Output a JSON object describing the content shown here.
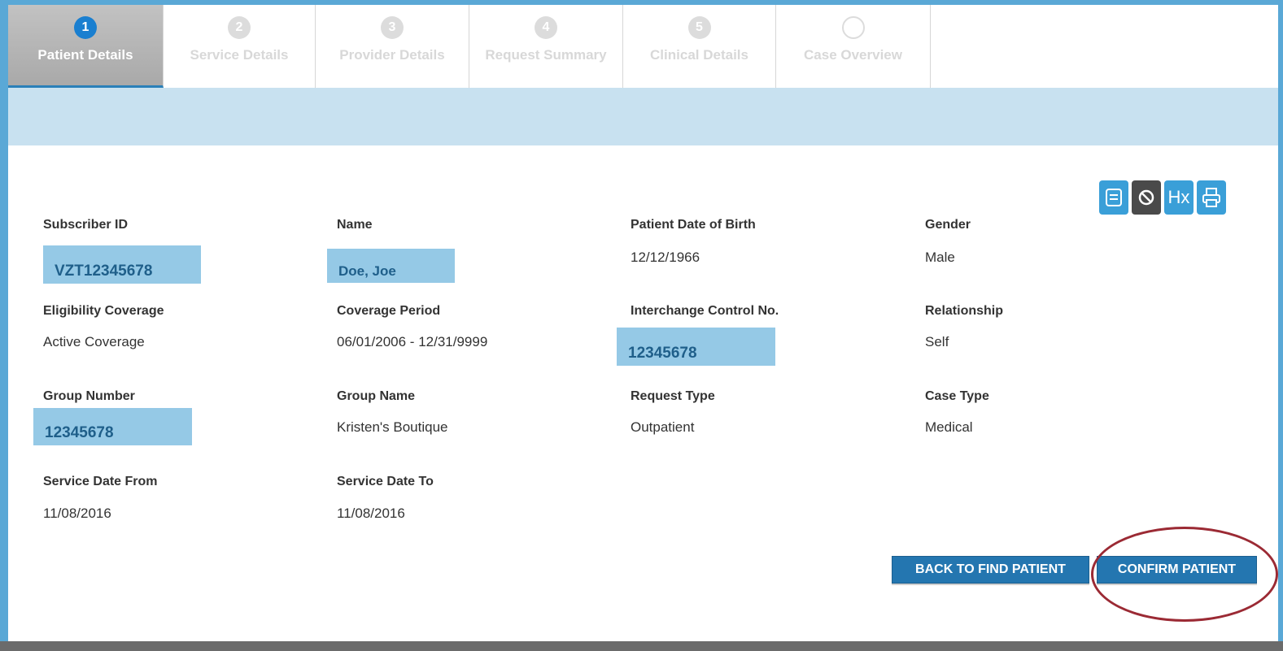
{
  "steps": [
    {
      "num": "1",
      "label": "Patient Details"
    },
    {
      "num": "2",
      "label": "Service Details"
    },
    {
      "num": "3",
      "label": "Provider Details"
    },
    {
      "num": "4",
      "label": "Request Summary"
    },
    {
      "num": "5",
      "label": "Clinical Details"
    },
    {
      "num": "",
      "label": "Case Overview"
    }
  ],
  "toolbar": {
    "icons": [
      "save-icon",
      "cancel-icon",
      "hx-icon",
      "print-icon"
    ],
    "hx_text": "Hx"
  },
  "fields": {
    "subscriber_id": {
      "label": "Subscriber ID",
      "value": "VZT12345678"
    },
    "name": {
      "label": "Name",
      "value": "Doe, Joe"
    },
    "dob": {
      "label": "Patient Date of Birth",
      "value": "12/12/1966"
    },
    "gender": {
      "label": "Gender",
      "value": "Male"
    },
    "eligibility": {
      "label": "Eligibility Coverage",
      "value": "Active Coverage"
    },
    "coverage_period": {
      "label": "Coverage Period",
      "value": "06/01/2006 - 12/31/9999"
    },
    "icn": {
      "label": "Interchange Control No.",
      "value": "12345678"
    },
    "relationship": {
      "label": "Relationship",
      "value": "Self"
    },
    "group_number": {
      "label": "Group Number",
      "value": "12345678"
    },
    "group_name": {
      "label": "Group Name",
      "value": "Kristen's Boutique"
    },
    "request_type": {
      "label": "Request Type",
      "value": "Outpatient"
    },
    "case_type": {
      "label": "Case Type",
      "value": "Medical"
    },
    "service_from": {
      "label": "Service Date From",
      "value": "11/08/2016"
    },
    "service_to": {
      "label": "Service Date To",
      "value": "11/08/2016"
    }
  },
  "actions": {
    "back": "BACK TO FIND PATIENT",
    "confirm": "CONFIRM PATIENT"
  },
  "colors": {
    "accent": "#2476b0",
    "highlight": "#95c9e6",
    "band": "#c8e1f0",
    "annotation": "#9b2a34"
  }
}
